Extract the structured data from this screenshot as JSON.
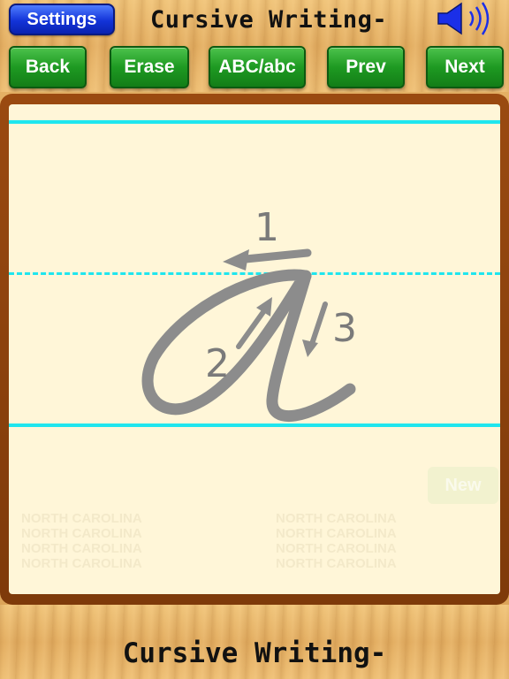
{
  "header": {
    "settings_label": "Settings",
    "title": "Cursive Writing-",
    "speaker_icon": "speaker-icon"
  },
  "toolbar": {
    "back_label": "Back",
    "erase_label": "Erase",
    "case_label": "ABC/abc",
    "prev_label": "Prev",
    "next_label": "Next"
  },
  "canvas": {
    "letter": "a",
    "stroke_numbers": [
      "1",
      "2",
      "3"
    ],
    "ghost_button_label": "New",
    "watermark_lines": [
      "NORTH CAROLINA",
      "NORTH CAROLINA",
      "NORTH CAROLINA",
      "NORTH CAROLINA"
    ]
  },
  "footer": {
    "title": "Cursive Writing-"
  },
  "colors": {
    "guide_line": "#1fe6ee",
    "paper": "#fff6d8",
    "frame": "#8a420c",
    "button_green": "#1e9a22",
    "button_blue": "#1233d8",
    "glyph_gray": "#8c8c8c"
  }
}
